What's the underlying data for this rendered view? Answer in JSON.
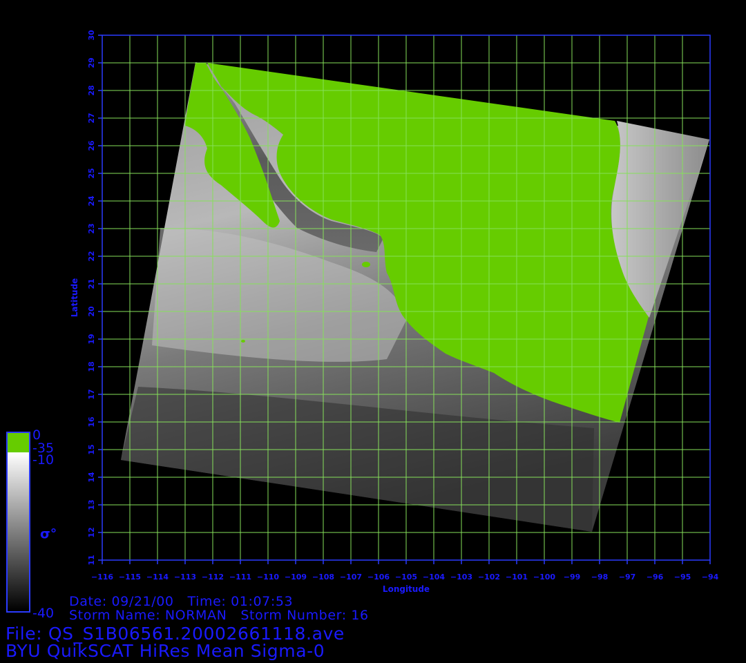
{
  "map": {
    "x_axis": {
      "title": "Longitude",
      "ticks": [
        "-116",
        "-115",
        "-114",
        "-113",
        "-112",
        "-111",
        "-110",
        "-109",
        "-108",
        "-107",
        "-106",
        "-105",
        "-104",
        "-103",
        "-102",
        "-101",
        "-100",
        "-99",
        "-98",
        "-97",
        "-96",
        "-95",
        "-94"
      ]
    },
    "y_axis": {
      "title": "Latitude",
      "ticks": [
        "11",
        "12",
        "13",
        "14",
        "15",
        "16",
        "17",
        "18",
        "19",
        "20",
        "21",
        "22",
        "23",
        "24",
        "25",
        "26",
        "27",
        "28",
        "29",
        "30"
      ]
    },
    "lon_range": [
      -116,
      -94
    ],
    "lat_range": [
      11,
      30
    ],
    "grid_color": "#86e05a",
    "frame_color": "#2b3bff",
    "land_color": "#66cc00"
  },
  "colorbar": {
    "label": "σ°",
    "top_label": "0",
    "land_label": "-35",
    "upper_label": "-10",
    "bottom_label": "-40"
  },
  "info": {
    "date_label": "Date:",
    "date_value": "09/21/00",
    "time_label": "Time:",
    "time_value": "01:07:53",
    "storm_name_label": "Storm Name:",
    "storm_name_value": "NORMAN",
    "storm_number_label": "Storm Number:",
    "storm_number_value": "16",
    "file_label": "File:",
    "file_value": "QS_S1B06561.20002661118.ave",
    "product_title": "BYU QuikSCAT HiRes Mean Sigma-0"
  }
}
